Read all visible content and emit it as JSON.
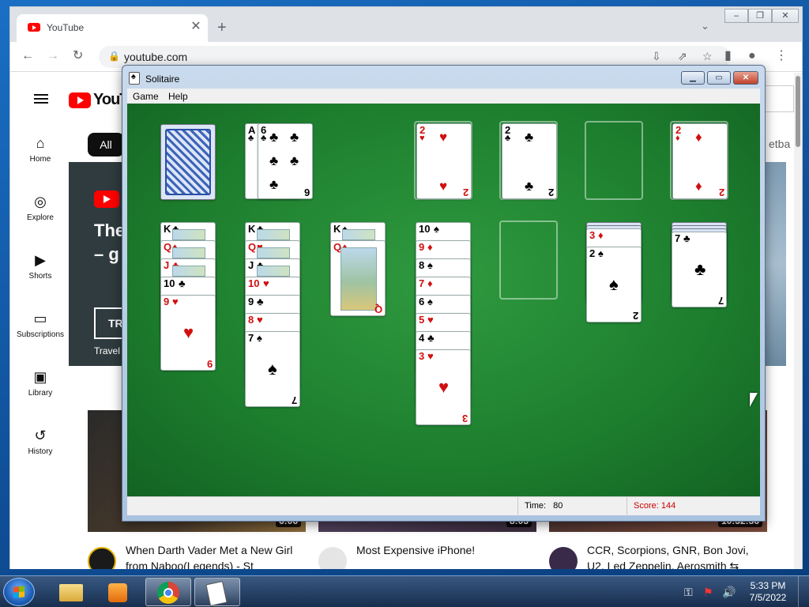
{
  "browser": {
    "tab_title": "YouTube",
    "tab_close": "✕",
    "new_tab": "+",
    "url": "youtube.com",
    "window_controls": [
      "‒",
      "❐",
      "✕"
    ]
  },
  "youtube": {
    "logo_text": "YouTube",
    "nav": [
      {
        "icon": "⌂",
        "label": "Home"
      },
      {
        "icon": "◎",
        "label": "Explore"
      },
      {
        "icon": "▶",
        "label": "Shorts"
      },
      {
        "icon": "▭",
        "label": "Subscriptions"
      },
      {
        "icon": "▣",
        "label": "Library"
      },
      {
        "icon": "↺",
        "label": "History"
      }
    ],
    "chip_all": "All",
    "chip_partial": "etba",
    "banner": {
      "title_line1": "The",
      "title_line2": "– g",
      "button_text": "TR",
      "subtitle": "Travel"
    },
    "videos": [
      {
        "duration": "6:06",
        "title": "When Darth Vader Met a New Girl from Naboo(Legends) - St"
      },
      {
        "duration": "8:03",
        "title": "Most Expensive iPhone!"
      },
      {
        "duration": "10:32:36",
        "title": "CCR, Scorpions, GNR, Bon Jovi, U2, Led Zeppelin, Aerosmith ⇆"
      }
    ]
  },
  "solitaire": {
    "title": "Solitaire",
    "menu": [
      "Game",
      "Help"
    ],
    "status": {
      "time_label": "Time:",
      "time_value": "80",
      "score_label": "Score:",
      "score_value": "144"
    },
    "waste_cards": [
      {
        "rank": "A",
        "suit": "♣"
      },
      {
        "rank": "6",
        "suit": "♣"
      }
    ],
    "foundations": [
      {
        "rank": "2",
        "suit": "♥",
        "color": "red"
      },
      {
        "rank": "2",
        "suit": "♣",
        "color": "blk"
      },
      null,
      {
        "rank": "2",
        "suit": "♦",
        "color": "red"
      }
    ],
    "tableau": [
      [
        {
          "rank": "K",
          "suit": "♣",
          "color": "blk"
        },
        {
          "rank": "Q",
          "suit": "♦",
          "color": "red"
        },
        {
          "rank": "J",
          "suit": "♣",
          "color": "red"
        },
        {
          "rank": "10",
          "suit": "♣",
          "color": "blk"
        },
        {
          "rank": "9",
          "suit": "♥",
          "color": "red"
        }
      ],
      [
        {
          "rank": "K",
          "suit": "♣",
          "color": "blk"
        },
        {
          "rank": "Q",
          "suit": "♥",
          "color": "red"
        },
        {
          "rank": "J",
          "suit": "♣",
          "color": "blk"
        },
        {
          "rank": "10",
          "suit": "♥",
          "color": "red"
        },
        {
          "rank": "9",
          "suit": "♣",
          "color": "blk"
        },
        {
          "rank": "8",
          "suit": "♥",
          "color": "red"
        },
        {
          "rank": "7",
          "suit": "♠",
          "color": "blk"
        }
      ],
      [
        {
          "rank": "K",
          "suit": "♠",
          "color": "blk"
        },
        {
          "rank": "Q",
          "suit": "♦",
          "color": "red"
        }
      ],
      [
        {
          "rank": "10",
          "suit": "♠",
          "color": "blk"
        },
        {
          "rank": "9",
          "suit": "♦",
          "color": "red"
        },
        {
          "rank": "8",
          "suit": "♠",
          "color": "blk"
        },
        {
          "rank": "7",
          "suit": "♦",
          "color": "red"
        },
        {
          "rank": "6",
          "suit": "♠",
          "color": "blk"
        },
        {
          "rank": "5",
          "suit": "♥",
          "color": "red"
        },
        {
          "rank": "4",
          "suit": "♣",
          "color": "blk"
        },
        {
          "rank": "3",
          "suit": "♥",
          "color": "red"
        }
      ],
      [],
      [
        {
          "rank": "3",
          "suit": "♦",
          "color": "red"
        },
        {
          "rank": "2",
          "suit": "♠",
          "color": "blk"
        }
      ],
      [
        {
          "rank": "7",
          "suit": "♣",
          "color": "blk"
        }
      ]
    ]
  },
  "taskbar": {
    "clock_time": "5:33 PM",
    "clock_date": "7/5/2022"
  },
  "colors": {
    "felt": "#1d7e2e",
    "score_red": "#c80000",
    "youtube_red": "#ff0000"
  }
}
